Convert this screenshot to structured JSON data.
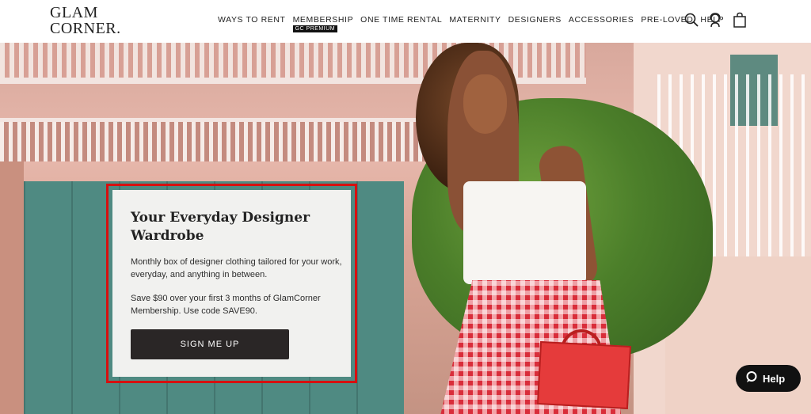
{
  "logo": {
    "line1": "GLAM",
    "line2": "CORNER."
  },
  "nav": {
    "items": [
      {
        "label": "WAYS TO RENT"
      },
      {
        "label": "MEMBERSHIP",
        "badge": "GC PREMIUM"
      },
      {
        "label": "ONE TIME RENTAL"
      },
      {
        "label": "MATERNITY"
      },
      {
        "label": "DESIGNERS"
      },
      {
        "label": "ACCESSORIES"
      },
      {
        "label": "PRE-LOVED"
      },
      {
        "label": "HELP"
      }
    ]
  },
  "header_icons": [
    "search-icon",
    "support-agent-icon",
    "shopping-bag-icon"
  ],
  "hero": {
    "card": {
      "title": "Your Everyday Designer Wardrobe",
      "description": "Monthly box of designer clothing tailored for your work, everyday, and anything in between.",
      "promo": "Save $90 over your first 3 months of GlamCorner Membership. Use code SAVE90.",
      "button_label": "SIGN ME UP"
    }
  },
  "help_widget": {
    "label": "Help",
    "icon": "chat-bubble-icon"
  },
  "colors": {
    "highlight_outline": "#d70f0f",
    "button_bg": "#2a2626",
    "card_bg": "#f1f1ef"
  }
}
